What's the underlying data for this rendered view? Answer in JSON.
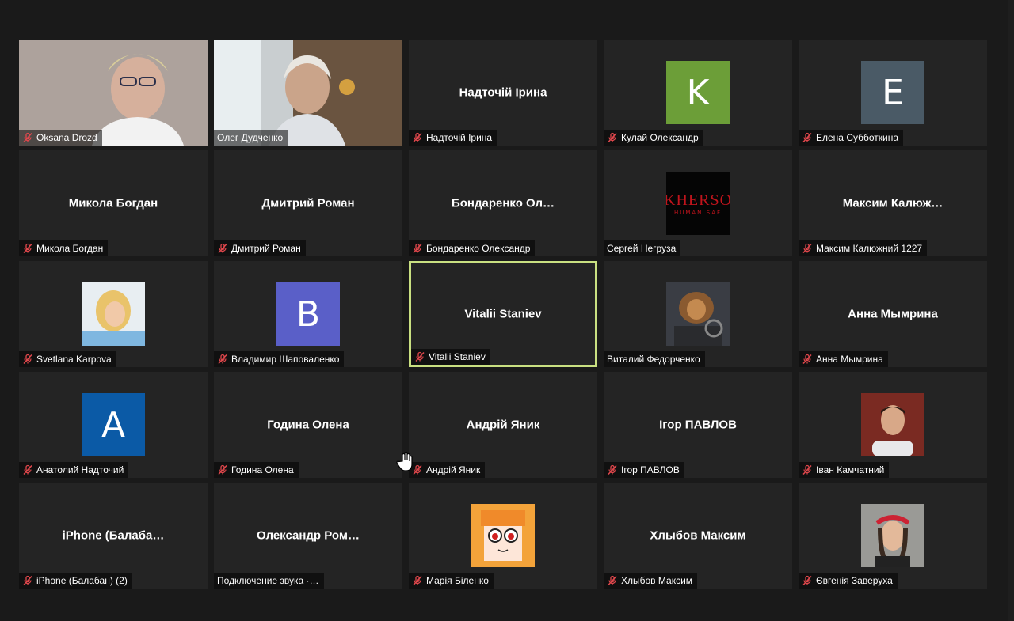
{
  "participants": [
    {
      "id": "p1",
      "label": "Oksana Drozd",
      "muted": true,
      "type": "video",
      "bg": "#8a8680"
    },
    {
      "id": "p2",
      "label": "Олег Дудченко",
      "muted": false,
      "type": "video",
      "bg": "#7a6a58"
    },
    {
      "id": "p3",
      "label": "Надточій Ірина",
      "center": "Надточій Ірина",
      "muted": true,
      "type": "name"
    },
    {
      "id": "p4",
      "label": "Кулай Олександр",
      "muted": true,
      "type": "letter",
      "letter": "K",
      "avatar_color": "#6c9e38"
    },
    {
      "id": "p5",
      "label": "Елена Субботкина",
      "muted": true,
      "type": "letter",
      "letter": "E",
      "avatar_color": "#4a5a66"
    },
    {
      "id": "p6",
      "label": "Микола Богдан",
      "center": "Микола Богдан",
      "muted": true,
      "type": "name"
    },
    {
      "id": "p7",
      "label": "Дмитрий Роман",
      "center": "Дмитрий Роман",
      "muted": true,
      "type": "name"
    },
    {
      "id": "p8",
      "label": "Бондаренко Олександр",
      "center": "Бондаренко  Ол…",
      "muted": true,
      "type": "name"
    },
    {
      "id": "p9",
      "label": "Сергей Негруза",
      "muted": false,
      "type": "logo",
      "logo_text": "KHERSO",
      "logo_sub": "HUMAN SAF"
    },
    {
      "id": "p10",
      "label": "Максим Калюжний 1227",
      "center": "Максим  Калюж…",
      "muted": true,
      "type": "name"
    },
    {
      "id": "p11",
      "label": "Svetlana Karpova",
      "muted": true,
      "type": "photo",
      "photo": "woman-blonde"
    },
    {
      "id": "p12",
      "label": "Владимир Шаповаленко",
      "muted": true,
      "type": "letter",
      "letter": "B",
      "avatar_color": "#5a5fc8"
    },
    {
      "id": "p13",
      "label": "Vitalii Staniev",
      "center": "Vitalii Staniev",
      "muted": true,
      "type": "name",
      "active": true
    },
    {
      "id": "p14",
      "label": "Виталий Федорченко",
      "muted": false,
      "type": "photo",
      "photo": "lion"
    },
    {
      "id": "p15",
      "label": "Анна Мымрина",
      "center": "Анна Мымрина",
      "muted": true,
      "type": "name"
    },
    {
      "id": "p16",
      "label": "Анатолий Надточий",
      "muted": true,
      "type": "letter",
      "letter": "A",
      "avatar_color": "#0b5aa6"
    },
    {
      "id": "p17",
      "label": "Година Олена",
      "center": "Година Олена",
      "muted": true,
      "type": "name"
    },
    {
      "id": "p18",
      "label": "Андрій Яник",
      "center": "Андрій Яник",
      "muted": true,
      "type": "name"
    },
    {
      "id": "p19",
      "label": "Ігор ПАВЛОВ",
      "center": "Ігор ПАВЛОВ",
      "muted": true,
      "type": "name"
    },
    {
      "id": "p20",
      "label": "Іван Камчатний",
      "muted": true,
      "type": "photo",
      "photo": "man"
    },
    {
      "id": "p21",
      "label": "iPhone (Балабан) (2)",
      "center": "iPhone  (Балаба…",
      "muted": true,
      "type": "name"
    },
    {
      "id": "p22",
      "label": "Подключение звука ·…",
      "center": "Олександр  Ром…",
      "muted": false,
      "type": "name"
    },
    {
      "id": "p23",
      "label": "Марія Біленко",
      "muted": true,
      "type": "photo",
      "photo": "anime"
    },
    {
      "id": "p24",
      "label": "Хлыбов Максим",
      "center": "Хлыбов Максим",
      "muted": true,
      "type": "name"
    },
    {
      "id": "p25",
      "label": "Євгенія Заверуха",
      "muted": true,
      "type": "photo",
      "photo": "woman-wreath"
    }
  ],
  "colors": {
    "active_border": "#c9e081",
    "mute_red": "#e0474c",
    "tile_bg": "#242424"
  }
}
